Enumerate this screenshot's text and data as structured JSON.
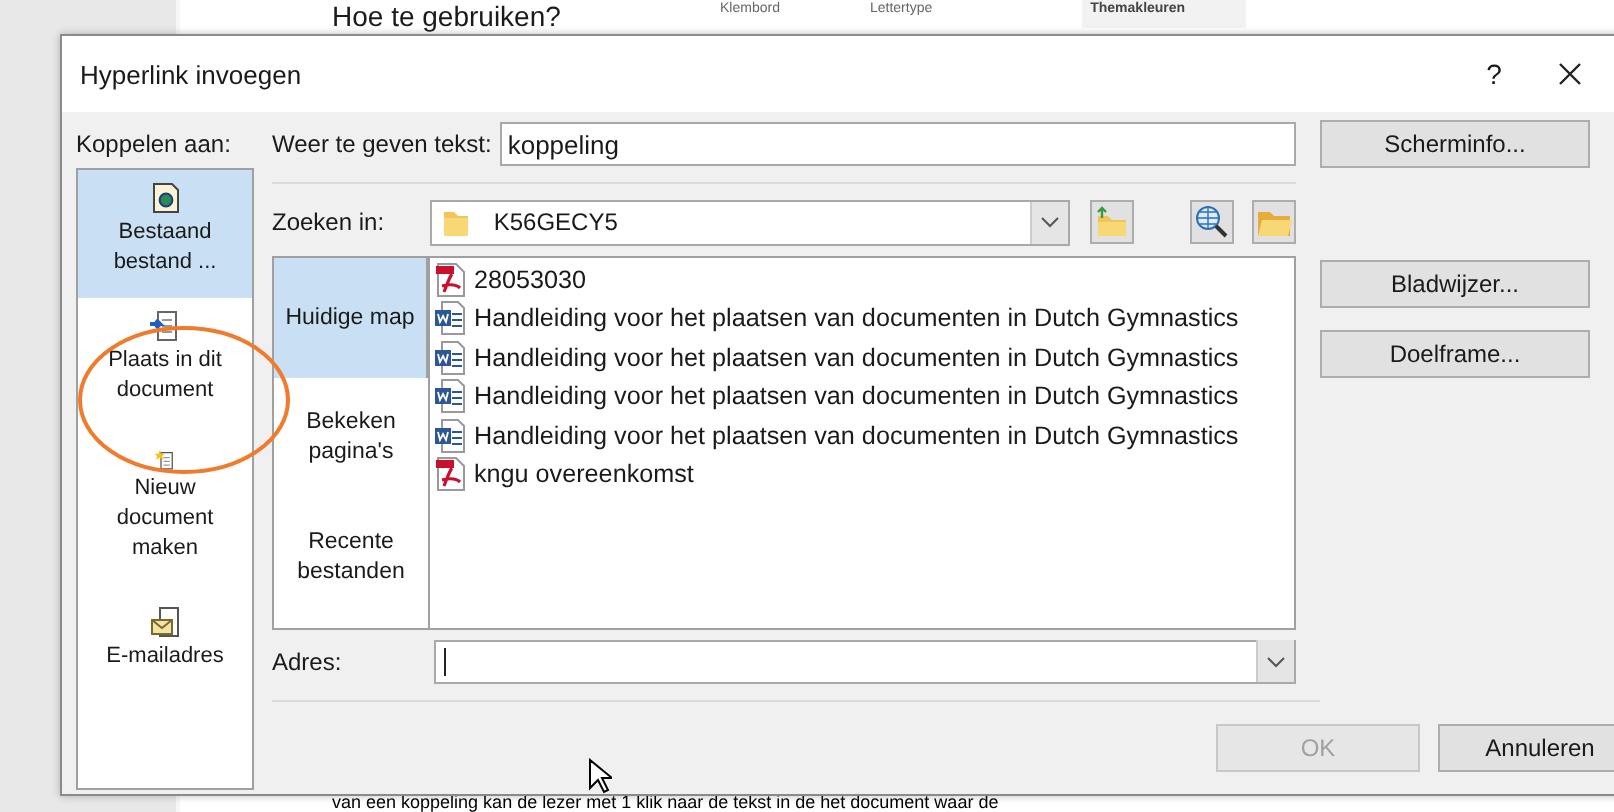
{
  "background_document": {
    "heading": "Hoe te gebruiken?",
    "ribbon_labels": [
      "Klembord",
      "Lettertype",
      "Themakleuren"
    ],
    "body_line": "van een koppeling kan de lezer met 1 klik naar de tekst in de het document waar de"
  },
  "window": {
    "title": "Hyperlink invoegen",
    "help": "?"
  },
  "link_to": {
    "label": "Koppelen aan:",
    "items": [
      {
        "label": "Bestaand bestand ...",
        "kind": "file",
        "selected": true
      },
      {
        "label": "Plaats in dit document",
        "kind": "place",
        "selected": false
      },
      {
        "label": "Nieuw document maken",
        "kind": "new",
        "selected": false
      },
      {
        "label": "E-mailadres",
        "kind": "email",
        "selected": false
      }
    ]
  },
  "display_text": {
    "label": "Weer te geven tekst:",
    "value": "koppeling"
  },
  "look_in": {
    "label": "Zoeken in:",
    "value": "K56GECY5"
  },
  "browse_sections": [
    {
      "label": "Huidige map",
      "selected": true
    },
    {
      "label": "Bekeken pagina's",
      "selected": false
    },
    {
      "label": "Recente bestanden",
      "selected": false
    }
  ],
  "files": [
    {
      "name": "28053030",
      "kind": "pdf"
    },
    {
      "name": "Handleiding voor het plaatsen van documenten in Dutch Gymnastics",
      "kind": "word"
    },
    {
      "name": "Handleiding voor het plaatsen van documenten in Dutch Gymnastics",
      "kind": "word"
    },
    {
      "name": "Handleiding voor het plaatsen van documenten in Dutch Gymnastics",
      "kind": "word"
    },
    {
      "name": "Handleiding voor het plaatsen van documenten in Dutch Gymnastics",
      "kind": "word"
    },
    {
      "name": "kngu overeenkomst",
      "kind": "pdf"
    }
  ],
  "address": {
    "label": "Adres:"
  },
  "side_buttons": [
    {
      "label": "Scherminfo..."
    },
    {
      "label": "Bladwijzer..."
    },
    {
      "label": "Doelframe..."
    }
  ],
  "buttons": [
    {
      "label": "OK",
      "disabled": true
    },
    {
      "label": "Annuleren",
      "disabled": false
    }
  ]
}
